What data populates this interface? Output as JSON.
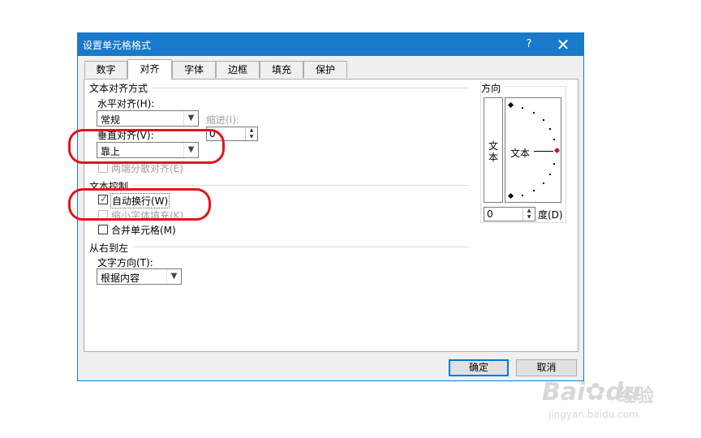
{
  "dialog": {
    "title": "设置单元格格式",
    "help": "?",
    "close": "✕"
  },
  "tabs": [
    {
      "label": "数字"
    },
    {
      "label": "对齐",
      "active": true
    },
    {
      "label": "字体"
    },
    {
      "label": "边框"
    },
    {
      "label": "填充"
    },
    {
      "label": "保护"
    }
  ],
  "alignment": {
    "section_title": "文本对齐方式",
    "horizontal_label": "水平对齐(H):",
    "horizontal_value": "常规",
    "indent_label": "缩进(I):",
    "indent_value": "0",
    "vertical_label": "垂直对齐(V):",
    "vertical_value": "靠上",
    "distributed_label": "两端分散对齐(E)"
  },
  "text_control": {
    "section_title": "文本控制",
    "wrap_label": "自动换行(W)",
    "wrap_checked": true,
    "shrink_label": "缩小字体填充(K)",
    "shrink_checked": false,
    "merge_label": "合并单元格(M)",
    "merge_checked": false
  },
  "rtl": {
    "section_title": "从右到左",
    "direction_label": "文字方向(T):",
    "direction_value": "根据内容"
  },
  "orientation": {
    "section_title": "方向",
    "vertical_text": [
      "文",
      "本"
    ],
    "dial_text": "文本",
    "degree_value": "0",
    "degree_label": "度(D)"
  },
  "footer": {
    "ok": "确定",
    "cancel": "取消"
  },
  "watermark": {
    "brand": "Bai",
    "brand2": "du",
    "suffix": "经验",
    "url": "jingyan.baidu.com"
  },
  "colors": {
    "title_bar": "#1979ca",
    "annotation": "#e3141b"
  }
}
